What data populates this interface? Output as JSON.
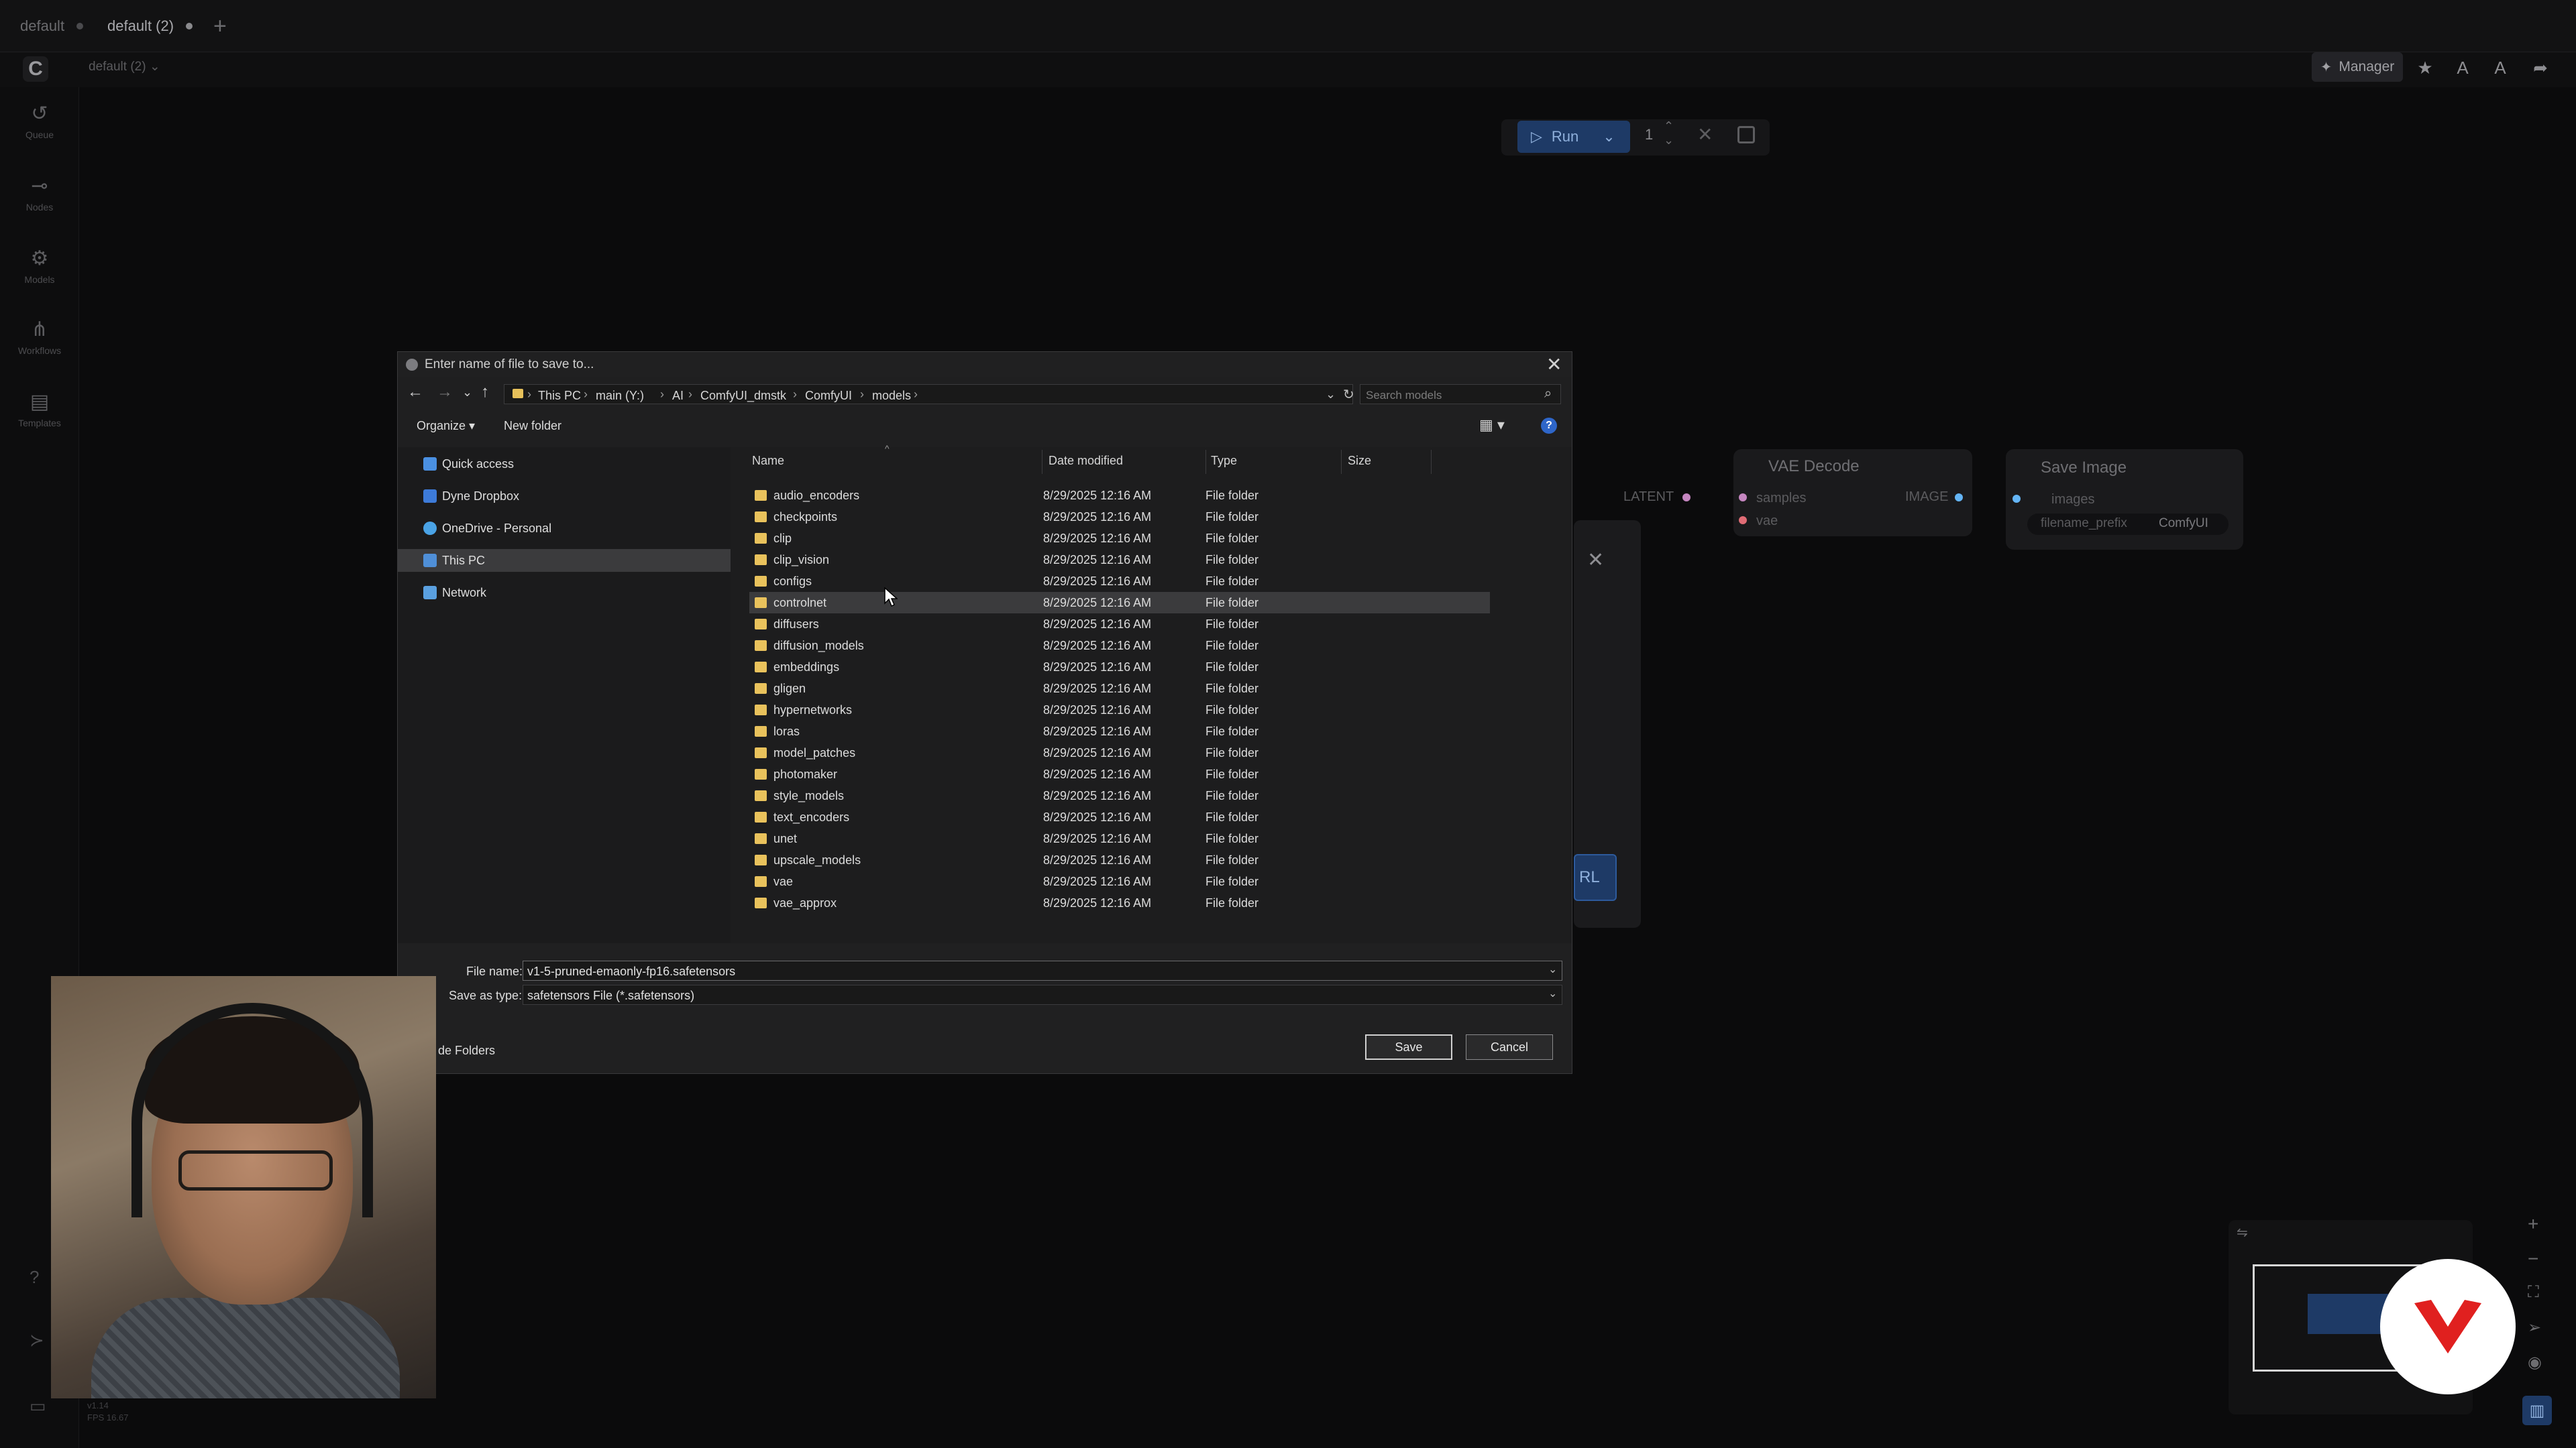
{
  "tabs": [
    {
      "label": "default"
    },
    {
      "label": "default (2)"
    }
  ],
  "menubar": {
    "workflow_name": "default (2) ⌄"
  },
  "toolbar_right": {
    "manager_label": "Manager"
  },
  "sidebar": {
    "items": [
      {
        "label": "Queue",
        "icon": "history-icon"
      },
      {
        "label": "Nodes",
        "icon": "nodes-icon"
      },
      {
        "label": "Models",
        "icon": "models-icon"
      },
      {
        "label": "Workflows",
        "icon": "workflows-icon"
      },
      {
        "label": "Templates",
        "icon": "templates-icon"
      }
    ],
    "version_line1": "v1.14",
    "version_line2": "FPS 16.67"
  },
  "runbar": {
    "run_label": "Run",
    "count": "1"
  },
  "graph": {
    "vae_decode": {
      "title": "VAE Decode",
      "in1": "samples",
      "in2": "vae",
      "out": "IMAGE",
      "left_label": "LATENT"
    },
    "save_image": {
      "title": "Save Image",
      "in1": "images",
      "widget_label": "filename_prefix",
      "widget_value": "ComfyUI"
    }
  },
  "bg_modal": {
    "url_button": "RL"
  },
  "dialog": {
    "title": "Enter name of file to save to...",
    "breadcrumbs": [
      "This PC",
      "main (Y:)",
      "AI",
      "ComfyUI_dmstk",
      "ComfyUI",
      "models"
    ],
    "search_placeholder": "Search models",
    "organize_label": "Organize ▾",
    "new_folder_label": "New folder",
    "nav": [
      {
        "label": "Quick access",
        "color": "#4a90e2"
      },
      {
        "label": "Dyne Dropbox",
        "color": "#3d7bd9"
      },
      {
        "label": "OneDrive - Personal",
        "color": "#4aa3e6"
      },
      {
        "label": "This PC",
        "color": "#4f8fd8"
      },
      {
        "label": "Network",
        "color": "#5aa0e0"
      }
    ],
    "columns": {
      "name": "Name",
      "date": "Date modified",
      "type": "Type",
      "size": "Size"
    },
    "files": [
      {
        "name": "audio_encoders",
        "date": "8/29/2025 12:16 AM",
        "type": "File folder"
      },
      {
        "name": "checkpoints",
        "date": "8/29/2025 12:16 AM",
        "type": "File folder"
      },
      {
        "name": "clip",
        "date": "8/29/2025 12:16 AM",
        "type": "File folder"
      },
      {
        "name": "clip_vision",
        "date": "8/29/2025 12:16 AM",
        "type": "File folder"
      },
      {
        "name": "configs",
        "date": "8/29/2025 12:16 AM",
        "type": "File folder"
      },
      {
        "name": "controlnet",
        "date": "8/29/2025 12:16 AM",
        "type": "File folder"
      },
      {
        "name": "diffusers",
        "date": "8/29/2025 12:16 AM",
        "type": "File folder"
      },
      {
        "name": "diffusion_models",
        "date": "8/29/2025 12:16 AM",
        "type": "File folder"
      },
      {
        "name": "embeddings",
        "date": "8/29/2025 12:16 AM",
        "type": "File folder"
      },
      {
        "name": "gligen",
        "date": "8/29/2025 12:16 AM",
        "type": "File folder"
      },
      {
        "name": "hypernetworks",
        "date": "8/29/2025 12:16 AM",
        "type": "File folder"
      },
      {
        "name": "loras",
        "date": "8/29/2025 12:16 AM",
        "type": "File folder"
      },
      {
        "name": "model_patches",
        "date": "8/29/2025 12:16 AM",
        "type": "File folder"
      },
      {
        "name": "photomaker",
        "date": "8/29/2025 12:16 AM",
        "type": "File folder"
      },
      {
        "name": "style_models",
        "date": "8/29/2025 12:16 AM",
        "type": "File folder"
      },
      {
        "name": "text_encoders",
        "date": "8/29/2025 12:16 AM",
        "type": "File folder"
      },
      {
        "name": "unet",
        "date": "8/29/2025 12:16 AM",
        "type": "File folder"
      },
      {
        "name": "upscale_models",
        "date": "8/29/2025 12:16 AM",
        "type": "File folder"
      },
      {
        "name": "vae",
        "date": "8/29/2025 12:16 AM",
        "type": "File folder"
      },
      {
        "name": "vae_approx",
        "date": "8/29/2025 12:16 AM",
        "type": "File folder"
      }
    ],
    "selected_row": 5,
    "file_name_label": "File name:",
    "file_name_value": "v1-5-pruned-emaonly-fp16.safetensors",
    "save_type_label": "Save as type:",
    "save_type_value": "safetensors File (*.safetensors)",
    "hide_folders_label": "de Folders",
    "save_label": "Save",
    "cancel_label": "Cancel"
  }
}
